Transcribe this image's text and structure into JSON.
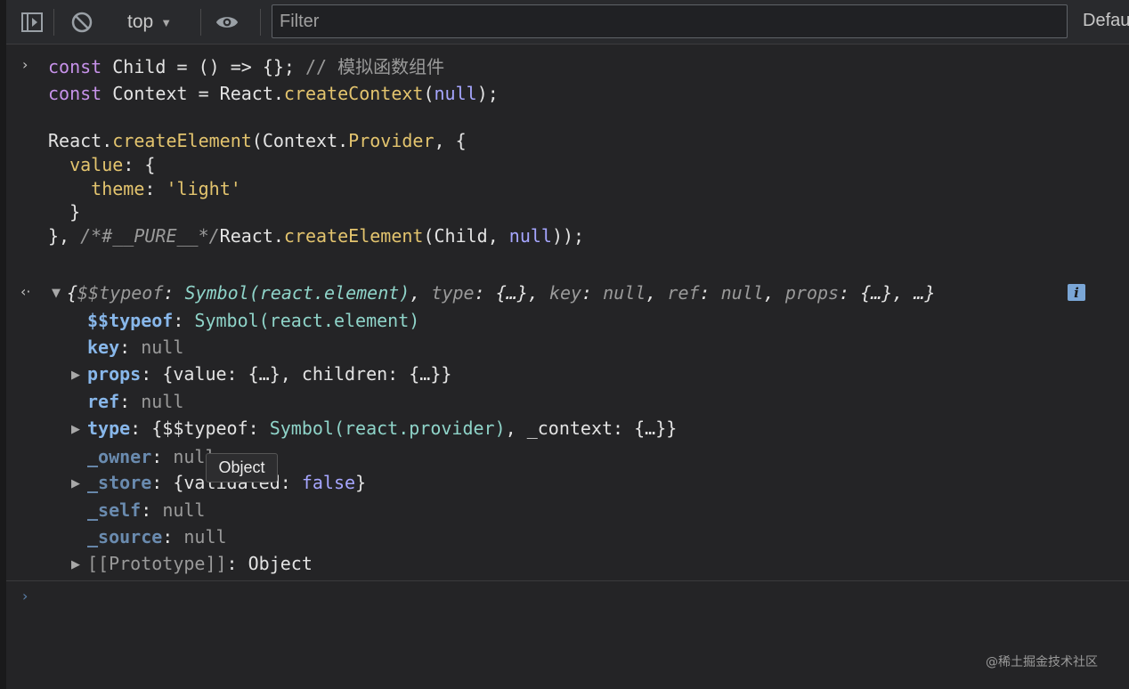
{
  "toolbar": {
    "icons": [
      "sidebar-toggle-icon",
      "clear-console-icon",
      "eye-icon"
    ],
    "context": "top",
    "filter_placeholder": "Filter",
    "levels_label": "Defau"
  },
  "input": {
    "line1": {
      "kw": "const",
      "name": " Child = () => {}; ",
      "comment": "// 模拟函数组件"
    },
    "line2": {
      "kw": "const",
      "name": " Context = React.",
      "fn": "createContext",
      "open": "(",
      "nul": "null",
      "close": ");"
    },
    "line3": {
      "a": "React.",
      "fn": "createElement",
      "b": "(Context.",
      "prop": "Provider",
      "c": ", {"
    },
    "line4": {
      "indent": "  ",
      "prop": "value",
      "rest": ": {"
    },
    "line5": {
      "indent": "    ",
      "prop": "theme",
      "colon": ": ",
      "str": "'light'"
    },
    "line6": {
      "text": "  }"
    },
    "line7": {
      "a": "}, ",
      "cmt": "/*#__PURE__*/",
      "b": "React.",
      "fn": "createElement",
      "c": "(Child, ",
      "nul": "null",
      "d": "));"
    }
  },
  "result": {
    "summary": {
      "open": "{",
      "k1": "$$typeof",
      "c1": ": ",
      "v1": "Symbol(react.element)",
      "s1": ", ",
      "k2": "type",
      "c2": ": ",
      "v2": "{…}",
      "s2": ", ",
      "k3": "key",
      "c3": ": ",
      "v3": "null",
      "s3": ", ",
      "k4": "ref",
      "c4": ": ",
      "v4": "null",
      "s4": ", ",
      "k5": "props",
      "c5": ": ",
      "v5": "{…}",
      "s5": ", …}"
    },
    "info_badge": "i",
    "rows": {
      "typeof": {
        "key": "$$typeof",
        "colon": ": ",
        "val": "Symbol(react.element)"
      },
      "key": {
        "key": "key",
        "colon": ": ",
        "val": "null"
      },
      "props": {
        "key": "props",
        "colon": ": ",
        "val": "{value: {…}, children: {…}}"
      },
      "ref": {
        "key": "ref",
        "colon": ": ",
        "val": "null"
      },
      "type": {
        "key": "type",
        "colon": ": ",
        "a": "{$$typeof: ",
        "sym": "Symbol(react.provider)",
        "b": ", _context: {…}}"
      },
      "owner": {
        "key": "_owner",
        "colon": ": ",
        "val": "null"
      },
      "store": {
        "key": "_store",
        "colon": ": ",
        "a": "{validated: ",
        "bool": "false",
        "b": "}"
      },
      "self": {
        "key": "_self",
        "colon": ": ",
        "val": "null"
      },
      "source": {
        "key": "_source",
        "colon": ": ",
        "val": "null"
      },
      "proto": {
        "key": "[[Prototype]]",
        "colon": ": ",
        "val": "Object"
      }
    }
  },
  "tooltip": "Object",
  "watermark": "@稀土掘金技术社区",
  "colors": {
    "background": "#242426",
    "toolbar": "#292a2d",
    "keyword": "#c792ea",
    "function": "#e3c46e",
    "symbol": "#8fd4c9",
    "key": "#88b7ea",
    "boolean": "#a6a6ff",
    "info": "#7aa6d6"
  }
}
